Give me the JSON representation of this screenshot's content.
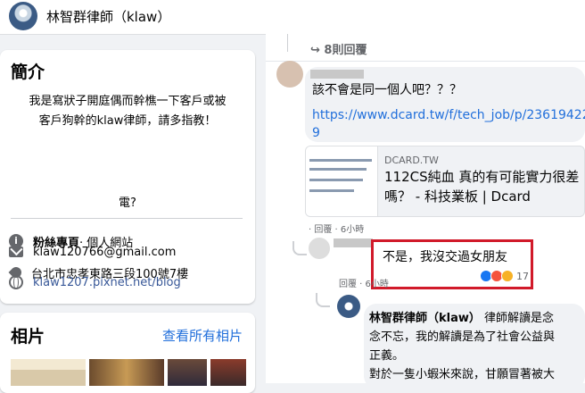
{
  "header": {
    "title": "林智群律師（klaw）"
  },
  "intro": {
    "heading": "簡介",
    "bio_line1": "我是寫狀子開庭偶而幹樵一下客戶或被",
    "bio_line2": "客戶狗幹的klaw律師，請多指教！",
    "bio_line3": "電?",
    "page_type_bold": "粉絲專頁",
    "page_type_rest": " · 個人網站",
    "address": "台北市忠孝東路三段100號7樓",
    "email": "klaw120766@gmail.com",
    "website": "klaw1207.pixnet.net/blog"
  },
  "photos": {
    "heading": "相片",
    "see_all": "查看所有相片"
  },
  "comments": {
    "replies_label": "8則回覆",
    "c1_text": "該不會是同一個人吧？？？",
    "c1_url_line1": "https://www.dcard.tw/f/tech_job/p/23619422",
    "c1_url_line2": "9",
    "preview_domain": "DCARD.TW",
    "preview_title": "112CS純血 真的有可能實力很差嗎？ - 科技業板 | Dcard",
    "c1_meta": "· 回覆 · 6小時",
    "c2_text": "不是，我沒交過女朋友",
    "c2_reactions": "17",
    "c2_meta": "回覆 · 6小時",
    "c3_author": "林智群律師（klaw）",
    "c3_line1": " 律師解讀是念",
    "c3_line2": "念不忘，我的解讀是為了社會公益與",
    "c3_line3": "正義。",
    "c3_line4": "對於一隻小蝦米來說，甘願冒著被大"
  },
  "colors": {
    "link": "#216fdb",
    "highlight_box": "#d11a2a"
  }
}
